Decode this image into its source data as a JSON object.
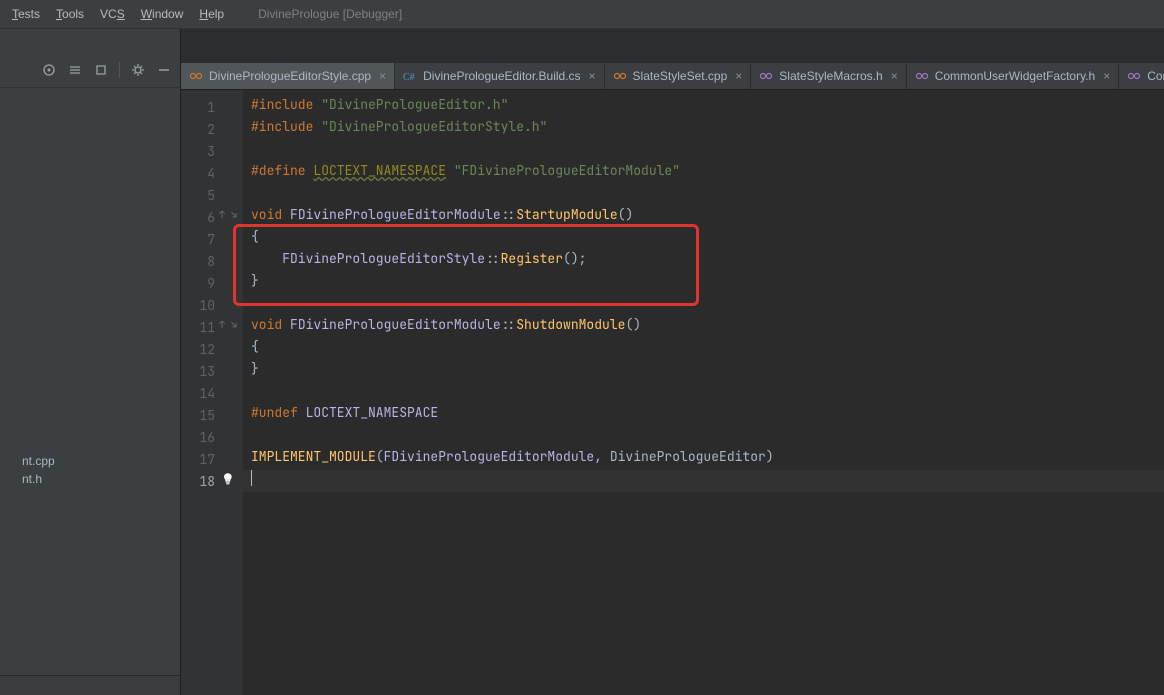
{
  "menubar": {
    "items": [
      "Tests",
      "Tools",
      "VCS",
      "Window",
      "Help"
    ],
    "underlines": [
      "T",
      "T",
      "S",
      "W",
      "H"
    ],
    "title": "DivinePrologue [Debugger]"
  },
  "sidebar": {
    "tree_nodes": [
      "nt.cpp",
      "nt.h"
    ]
  },
  "tabs": [
    {
      "label": "DivinePrologueEditorStyle.cpp",
      "icon": "cpp-file-icon",
      "active": true
    },
    {
      "label": "DivinePrologueEditor.Build.cs",
      "icon": "csharp-file-icon",
      "active": false
    },
    {
      "label": "SlateStyleSet.cpp",
      "icon": "cpp-file-icon",
      "active": false
    },
    {
      "label": "SlateStyleMacros.h",
      "icon": "header-file-icon",
      "active": false
    },
    {
      "label": "CommonUserWidgetFactory.h",
      "icon": "header-file-icon",
      "active": false
    },
    {
      "label": "Commo",
      "icon": "header-file-icon",
      "active": false
    }
  ],
  "code": {
    "line_count": 18,
    "current_line": 18,
    "lines": [
      {
        "n": 1,
        "raw": "#include \"DivinePrologueEditor.h\""
      },
      {
        "n": 2,
        "raw": "#include \"DivinePrologueEditorStyle.h\""
      },
      {
        "n": 3,
        "raw": ""
      },
      {
        "n": 4,
        "raw": "#define LOCTEXT_NAMESPACE \"FDivinePrologueEditorModule\""
      },
      {
        "n": 5,
        "raw": ""
      },
      {
        "n": 6,
        "raw": "void FDivinePrologueEditorModule::StartupModule()"
      },
      {
        "n": 7,
        "raw": "{"
      },
      {
        "n": 8,
        "raw": "    FDivinePrologueEditorStyle::Register();"
      },
      {
        "n": 9,
        "raw": "}"
      },
      {
        "n": 10,
        "raw": ""
      },
      {
        "n": 11,
        "raw": "void FDivinePrologueEditorModule::ShutdownModule()"
      },
      {
        "n": 12,
        "raw": "{"
      },
      {
        "n": 13,
        "raw": "}"
      },
      {
        "n": 14,
        "raw": ""
      },
      {
        "n": 15,
        "raw": "#undef LOCTEXT_NAMESPACE"
      },
      {
        "n": 16,
        "raw": ""
      },
      {
        "n": 17,
        "raw": "IMPLEMENT_MODULE(FDivinePrologueEditorModule, DivinePrologueEditor)"
      },
      {
        "n": 18,
        "raw": ""
      }
    ],
    "tokens": {
      "1": [
        [
          "kw",
          "#include "
        ],
        [
          "str",
          "\"DivinePrologueEditor.h\""
        ]
      ],
      "2": [
        [
          "kw",
          "#include "
        ],
        [
          "str",
          "\"DivinePrologueEditorStyle.h\""
        ]
      ],
      "4": [
        [
          "kw",
          "#define "
        ],
        [
          "mac",
          "LOCTEXT_NAMESPACE"
        ],
        [
          "ident",
          " "
        ],
        [
          "str",
          "\"FDivinePrologueEditorModule\""
        ]
      ],
      "6": [
        [
          "kw",
          "void "
        ],
        [
          "type",
          "FDivinePrologueEditorModule"
        ],
        [
          "ident",
          "::"
        ],
        [
          "func",
          "StartupModule"
        ],
        [
          "ident",
          "()"
        ]
      ],
      "7": [
        [
          "ident",
          "{"
        ]
      ],
      "8": [
        [
          "ident",
          "    "
        ],
        [
          "type",
          "FDivinePrologueEditorStyle"
        ],
        [
          "ident",
          "::"
        ],
        [
          "func",
          "Register"
        ],
        [
          "ident",
          "();"
        ]
      ],
      "9": [
        [
          "ident",
          "}"
        ]
      ],
      "11": [
        [
          "kw",
          "void "
        ],
        [
          "type",
          "FDivinePrologueEditorModule"
        ],
        [
          "ident",
          "::"
        ],
        [
          "func",
          "ShutdownModule"
        ],
        [
          "ident",
          "()"
        ]
      ],
      "12": [
        [
          "ident",
          "{"
        ]
      ],
      "13": [
        [
          "ident",
          "}"
        ]
      ],
      "15": [
        [
          "kw",
          "#undef "
        ],
        [
          "type",
          "LOCTEXT_NAMESPACE"
        ]
      ],
      "17": [
        [
          "func",
          "IMPLEMENT_MODULE"
        ],
        [
          "ident",
          "("
        ],
        [
          "type",
          "FDivinePrologueEditorModule"
        ],
        [
          "ident",
          ", DivinePrologueEditor)"
        ]
      ]
    }
  },
  "annotation_box": {
    "top_line": 7,
    "bottom_line": 9
  },
  "colors": {
    "keyword": "#cc7832",
    "string": "#6a8759",
    "type": "#b5b6e3",
    "function": "#ffc66d",
    "identifier": "#a9b7c6",
    "box": "#e0342e",
    "background": "#2b2b2b"
  }
}
